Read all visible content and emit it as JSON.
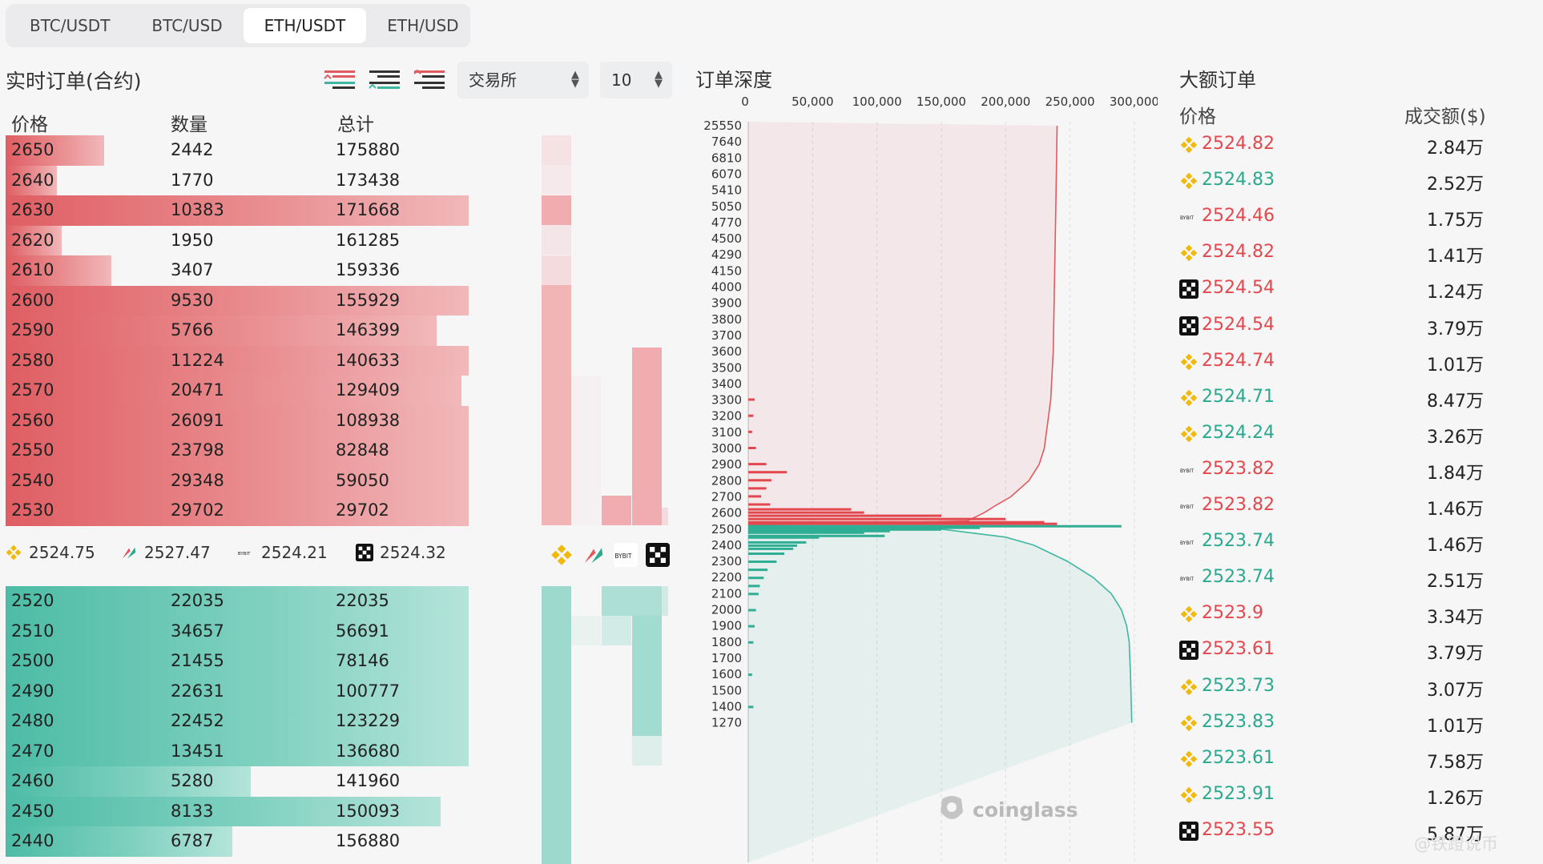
{
  "tabs": [
    "BTC/USDT",
    "BTC/USD",
    "ETH/USDT",
    "ETH/USD"
  ],
  "active_tab": 2,
  "left_title": "实时订单(合约)",
  "exchange_select": "交易所",
  "depth_select": "10",
  "headers": {
    "price": "价格",
    "qty": "数量",
    "total": "总计"
  },
  "asks": [
    {
      "p": "2650",
      "q": "2442",
      "t": "175880",
      "w": 0.213
    },
    {
      "p": "2640",
      "q": "1770",
      "t": "173438",
      "w": 0.11
    },
    {
      "p": "2630",
      "q": "10383",
      "t": "171668",
      "w": 1.0
    },
    {
      "p": "2620",
      "q": "1950",
      "t": "161285",
      "w": 0.121
    },
    {
      "p": "2610",
      "q": "3407",
      "t": "159336",
      "w": 0.229
    },
    {
      "p": "2600",
      "q": "9530",
      "t": "155929",
      "w": 1.0
    },
    {
      "p": "2590",
      "q": "5766",
      "t": "146399",
      "w": 0.93
    },
    {
      "p": "2580",
      "q": "11224",
      "t": "140633",
      "w": 1.0
    },
    {
      "p": "2570",
      "q": "20471",
      "t": "129409",
      "w": 0.985
    },
    {
      "p": "2560",
      "q": "26091",
      "t": "108938",
      "w": 1.0
    },
    {
      "p": "2550",
      "q": "23798",
      "t": "82848",
      "w": 1.0
    },
    {
      "p": "2540",
      "q": "29348",
      "t": "59050",
      "w": 1.0
    },
    {
      "p": "2530",
      "q": "29702",
      "t": "29702",
      "w": 1.0
    }
  ],
  "bids": [
    {
      "p": "2520",
      "q": "22035",
      "t": "22035",
      "w": 1.0
    },
    {
      "p": "2510",
      "q": "34657",
      "t": "56691",
      "w": 1.0
    },
    {
      "p": "2500",
      "q": "21455",
      "t": "78146",
      "w": 1.0
    },
    {
      "p": "2490",
      "q": "22631",
      "t": "100777",
      "w": 1.0
    },
    {
      "p": "2480",
      "q": "22452",
      "t": "123229",
      "w": 1.0
    },
    {
      "p": "2470",
      "q": "13451",
      "t": "136680",
      "w": 1.0
    },
    {
      "p": "2460",
      "q": "5280",
      "t": "141960",
      "w": 0.53
    },
    {
      "p": "2450",
      "q": "8133",
      "t": "150093",
      "w": 0.94
    },
    {
      "p": "2440",
      "q": "6787",
      "t": "156880",
      "w": 0.49
    }
  ],
  "exchange_prices": [
    {
      "ex": "binance",
      "price": "2524.75"
    },
    {
      "ex": "huobi",
      "price": "2527.47"
    },
    {
      "ex": "bybit",
      "price": "2524.21"
    },
    {
      "ex": "okx",
      "price": "2524.32"
    }
  ],
  "depth_title": "订单深度",
  "watermark": "coinglass",
  "big_orders": {
    "title": "大额订单",
    "col_price": "价格",
    "col_value": "成交额($)",
    "rows": [
      {
        "ex": "binance",
        "price": "2524.82",
        "side": "sell",
        "value": "2.84万"
      },
      {
        "ex": "binance",
        "price": "2524.83",
        "side": "buy",
        "value": "2.52万"
      },
      {
        "ex": "bybit",
        "price": "2524.46",
        "side": "sell",
        "value": "1.75万"
      },
      {
        "ex": "binance",
        "price": "2524.82",
        "side": "sell",
        "value": "1.41万"
      },
      {
        "ex": "okx",
        "price": "2524.54",
        "side": "sell",
        "value": "1.24万"
      },
      {
        "ex": "okx",
        "price": "2524.54",
        "side": "sell",
        "value": "3.79万"
      },
      {
        "ex": "binance",
        "price": "2524.74",
        "side": "sell",
        "value": "1.01万"
      },
      {
        "ex": "binance",
        "price": "2524.71",
        "side": "buy",
        "value": "8.47万"
      },
      {
        "ex": "binance",
        "price": "2524.24",
        "side": "buy",
        "value": "3.26万"
      },
      {
        "ex": "bybit",
        "price": "2523.82",
        "side": "sell",
        "value": "1.84万"
      },
      {
        "ex": "bybit",
        "price": "2523.82",
        "side": "sell",
        "value": "1.46万"
      },
      {
        "ex": "bybit",
        "price": "2523.74",
        "side": "buy",
        "value": "1.46万"
      },
      {
        "ex": "bybit",
        "price": "2523.74",
        "side": "buy",
        "value": "2.51万"
      },
      {
        "ex": "binance",
        "price": "2523.9",
        "side": "sell",
        "value": "3.34万"
      },
      {
        "ex": "okx",
        "price": "2523.61",
        "side": "sell",
        "value": "3.79万"
      },
      {
        "ex": "binance",
        "price": "2523.73",
        "side": "buy",
        "value": "3.07万"
      },
      {
        "ex": "binance",
        "price": "2523.83",
        "side": "buy",
        "value": "1.01万"
      },
      {
        "ex": "binance",
        "price": "2523.61",
        "side": "buy",
        "value": "7.58万"
      },
      {
        "ex": "binance",
        "price": "2523.91",
        "side": "buy",
        "value": "1.26万"
      },
      {
        "ex": "okx",
        "price": "2523.55",
        "side": "sell",
        "value": "5.87万"
      }
    ]
  },
  "signature": "@铁蹬说币",
  "colors": {
    "ask": "#e05a5f",
    "bid": "#3fb7a0",
    "binance": "#f0b90b",
    "sell_text": "#e4474c",
    "buy_text": "#2aa98e"
  },
  "chart_data": {
    "type": "bar",
    "orientation": "horizontal",
    "title": "订单深度",
    "x_ticks": [
      "0",
      "50,000",
      "100,000",
      "150,000",
      "200,000",
      "250,000",
      "300,000"
    ],
    "xlim": [
      0,
      315000
    ],
    "y_ticks": [
      "25550",
      "7640",
      "6810",
      "6070",
      "5410",
      "5050",
      "4770",
      "4500",
      "4290",
      "4150",
      "4000",
      "3900",
      "3800",
      "3700",
      "3600",
      "3500",
      "3400",
      "3300",
      "3200",
      "3100",
      "3000",
      "2900",
      "2800",
      "2700",
      "2600",
      "2500",
      "2400",
      "2300",
      "2200",
      "2100",
      "2000",
      "1900",
      "1800",
      "1700",
      "1600",
      "1500",
      "1400",
      "1270"
    ],
    "series": [
      {
        "side": "ask",
        "levels": [
          {
            "y": "3300",
            "v": 5000
          },
          {
            "y": "3200",
            "v": 4000
          },
          {
            "y": "3100",
            "v": 3000
          },
          {
            "y": "3000",
            "v": 6000
          },
          {
            "y": "2900",
            "v": 14000
          },
          {
            "y": "2850",
            "v": 30000
          },
          {
            "y": "2800",
            "v": 18000
          },
          {
            "y": "2750",
            "v": 14000
          },
          {
            "y": "2700",
            "v": 10000
          },
          {
            "y": "2650",
            "v": 17000
          },
          {
            "y": "2620",
            "v": 80000
          },
          {
            "y": "2600",
            "v": 90000
          },
          {
            "y": "2580",
            "v": 150000
          },
          {
            "y": "2560",
            "v": 200000
          },
          {
            "y": "2540",
            "v": 230000
          },
          {
            "y": "2530",
            "v": 240000
          }
        ],
        "cumulative": [
          {
            "y": "2525",
            "v": 0
          },
          {
            "y": "2550",
            "v": 170000
          },
          {
            "y": "2600",
            "v": 183000
          },
          {
            "y": "2650",
            "v": 193000
          },
          {
            "y": "2700",
            "v": 204000
          },
          {
            "y": "2800",
            "v": 218000
          },
          {
            "y": "2900",
            "v": 226000
          },
          {
            "y": "3000",
            "v": 230000
          },
          {
            "y": "3300",
            "v": 235000
          },
          {
            "y": "3600",
            "v": 237000
          },
          {
            "y": "5050",
            "v": 239000
          },
          {
            "y": "25550",
            "v": 240000
          }
        ]
      },
      {
        "side": "bid",
        "levels": [
          {
            "y": "2520",
            "v": 290000
          },
          {
            "y": "2510",
            "v": 180000
          },
          {
            "y": "2500",
            "v": 150000
          },
          {
            "y": "2490",
            "v": 110000
          },
          {
            "y": "2480",
            "v": 90000
          },
          {
            "y": "2460",
            "v": 106000
          },
          {
            "y": "2450",
            "v": 55000
          },
          {
            "y": "2420",
            "v": 45000
          },
          {
            "y": "2400",
            "v": 38000
          },
          {
            "y": "2380",
            "v": 35000
          },
          {
            "y": "2350",
            "v": 28000
          },
          {
            "y": "2300",
            "v": 22000
          },
          {
            "y": "2250",
            "v": 15000
          },
          {
            "y": "2200",
            "v": 12000
          },
          {
            "y": "2150",
            "v": 9000
          },
          {
            "y": "2100",
            "v": 8000
          },
          {
            "y": "2000",
            "v": 6000
          },
          {
            "y": "1900",
            "v": 5000
          },
          {
            "y": "1800",
            "v": 4000
          },
          {
            "y": "1600",
            "v": 3000
          },
          {
            "y": "1400",
            "v": 4000
          }
        ],
        "cumulative": [
          {
            "y": "2525",
            "v": 0
          },
          {
            "y": "2500",
            "v": 150000
          },
          {
            "y": "2450",
            "v": 200000
          },
          {
            "y": "2400",
            "v": 222000
          },
          {
            "y": "2300",
            "v": 248000
          },
          {
            "y": "2200",
            "v": 268000
          },
          {
            "y": "2100",
            "v": 282000
          },
          {
            "y": "2000",
            "v": 290000
          },
          {
            "y": "1900",
            "v": 294000
          },
          {
            "y": "1800",
            "v": 296000
          },
          {
            "y": "1600",
            "v": 297000
          },
          {
            "y": "1270",
            "v": 298000
          }
        ]
      }
    ]
  }
}
